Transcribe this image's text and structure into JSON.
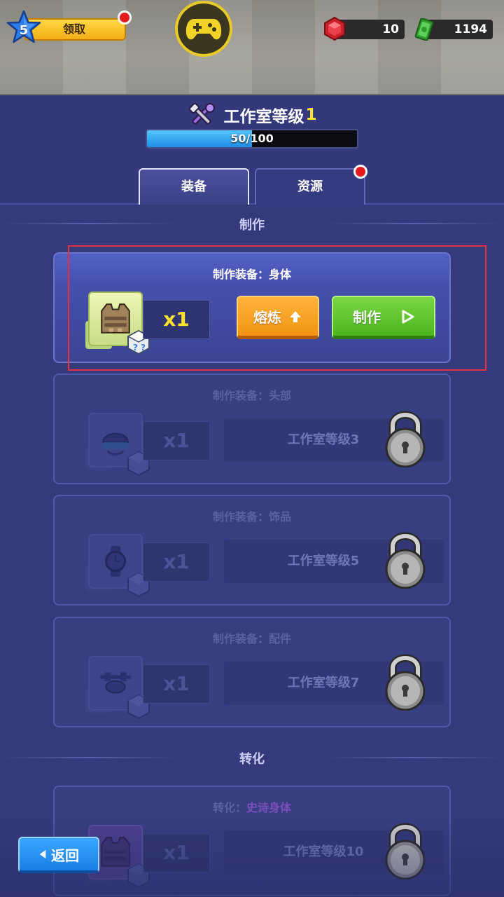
{
  "top_bar": {
    "player_level": "5",
    "claim_label": "领取",
    "gems": "10",
    "cash": "1194"
  },
  "header": {
    "title": "工作室等级",
    "level": "1",
    "progress_text": "50/100",
    "progress_fraction": 0.5
  },
  "tabs": [
    {
      "label": "装备",
      "selected": true
    },
    {
      "label": "资源",
      "selected": false,
      "has_notification": true
    }
  ],
  "sections": {
    "craft": "制作",
    "convert": "转化"
  },
  "cards": [
    {
      "title": "制作装备：身体",
      "quantity": "x1",
      "smelt_label": "熔炼",
      "make_label": "制作",
      "icon": "vest-icon"
    },
    {
      "title": "制作装备：头部",
      "quantity": "x1",
      "lock_text": "工作室等级3",
      "icon": "helmet-icon"
    },
    {
      "title": "制作装备：饰品",
      "quantity": "x1",
      "lock_text": "工作室等级5",
      "icon": "watch-icon"
    },
    {
      "title": "制作装备：配件",
      "quantity": "x1",
      "lock_text": "工作室等级7",
      "icon": "drone-icon"
    },
    {
      "title_prefix": "转化：",
      "title_highlight": "史诗身体",
      "quantity": "x1",
      "lock_text": "工作室等级10",
      "icon": "vest-icon"
    }
  ],
  "back_label": "返回",
  "colors": {
    "background": "#343a7c",
    "accent_yellow": "#ffe12c",
    "xp_blue": "#1e8fe6",
    "smelt_orange": "#f39412",
    "make_green": "#4cb41f",
    "highlight_red": "#e0333d",
    "epic_purple": "#8a4fd1"
  }
}
